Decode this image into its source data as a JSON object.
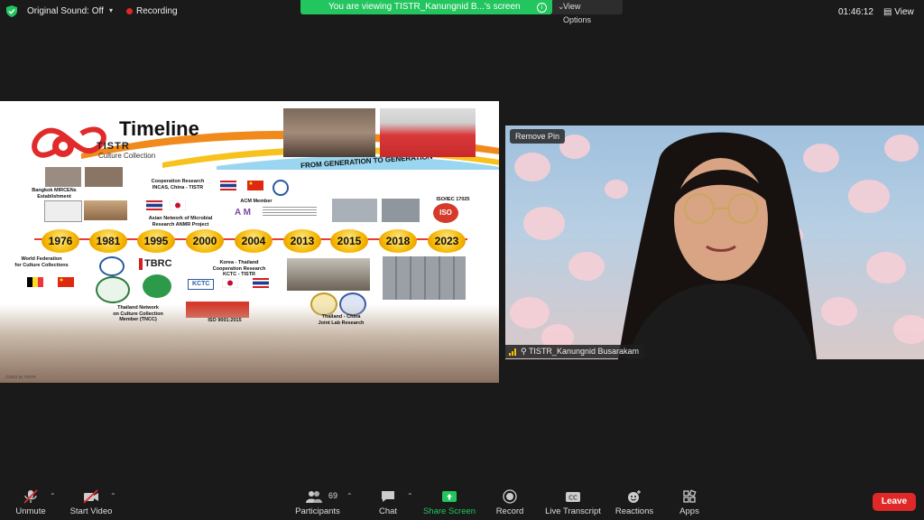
{
  "topbar": {
    "original_sound": "Original Sound: Off",
    "recording": "Recording",
    "banner": "You are viewing TISTR_Kanungnid B...'s screen",
    "view_options": "View Options",
    "clock": "01:46:12",
    "view": "View"
  },
  "slide": {
    "title": "Timeline",
    "brand": "TISTR",
    "brand_sub": "Culture Collection",
    "tagline": "FROM GENERATION TO GENERATION",
    "years": [
      "1976",
      "1981",
      "1995",
      "2000",
      "2004",
      "2013",
      "2015",
      "2018",
      "2023"
    ],
    "captions": {
      "mircen": "Bangkok MIRCENs\nEstablishment",
      "wfcc": "World Federation\nfor Culture Collections",
      "incas": "Cooperation Research\nINCAS, China - TISTR",
      "anmr": "Asian Network of Microbial\nResearch ANMR Project",
      "acm": "ACM Member",
      "iso17025": "ISO/IEC 17025",
      "tncc": "Thailand Network\non Culture Collection\nMember (TNCC)",
      "iso9001": "ISO 9001:2015",
      "korea": "Korea - Thailand\nCooperation Research\nKCTC - TISTR",
      "china": "Thailand - China\nJoint Lab Research"
    },
    "logos": {
      "tbrc": "TBRC",
      "kctc": "KCTC",
      "iso": "ISO",
      "am": "A M"
    },
    "copyright": "©2022 by TISTR"
  },
  "video": {
    "remove_pin": "Remove Pin",
    "participant_name": "TISTR_Kanungnid Busarakam"
  },
  "toolbar": {
    "unmute": "Unmute",
    "start_video": "Start Video",
    "participants": "Participants",
    "participants_count": "69",
    "chat": "Chat",
    "share_screen": "Share Screen",
    "record": "Record",
    "live_transcript": "Live Transcript",
    "reactions": "Reactions",
    "apps": "Apps",
    "leave": "Leave"
  },
  "colors": {
    "share_green": "#23c55e",
    "leave_red": "#e02828",
    "record_red": "#e02828",
    "accent_orange": "#f5b700"
  }
}
